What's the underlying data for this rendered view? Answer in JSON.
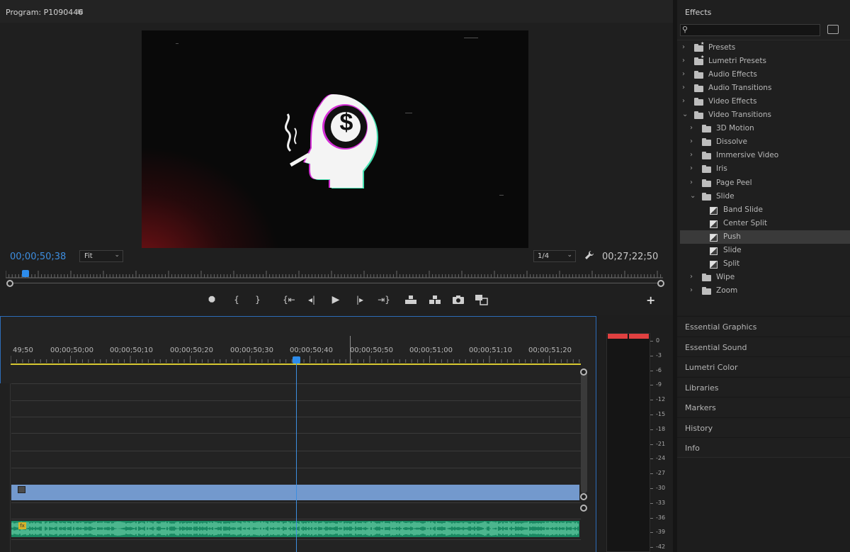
{
  "program": {
    "title": "Program: P1090446",
    "menu_icon": "≡",
    "timecode_current": "00;00;50;38",
    "fit_label": "Fit",
    "resolution_label": "1/4",
    "timecode_duration": "00;27;22;50",
    "add_icon": "+"
  },
  "video": {
    "dollar_symbol": "$"
  },
  "transport": {
    "buttons": [
      {
        "name": "add-marker-button",
        "glyph": "⯃"
      },
      {
        "name": "mark-in-button",
        "glyph": "{"
      },
      {
        "name": "mark-out-button",
        "glyph": "}"
      },
      {
        "name": "go-to-in-button",
        "glyph": "{⇤"
      },
      {
        "name": "step-back-button",
        "glyph": "◂|"
      },
      {
        "name": "play-button",
        "glyph": "▶"
      },
      {
        "name": "step-forward-button",
        "glyph": "|▸"
      },
      {
        "name": "go-to-out-button",
        "glyph": "⇥}"
      }
    ]
  },
  "timeline": {
    "ruler_labels": [
      "49;50",
      "00;00;50;00",
      "00;00;50;10",
      "00;00;50;20",
      "00;00;50;30",
      "00;00;50;40",
      "00;00;50;50",
      "00;00;51;00",
      "00;00;51;10",
      "00;00;51;20"
    ],
    "fx_badge": "fx"
  },
  "meters": {
    "db_labels": [
      "0",
      "-3",
      "-6",
      "-9",
      "-12",
      "-15",
      "-18",
      "-21",
      "-24",
      "-27",
      "-30",
      "-33",
      "-36",
      "-39",
      "-42"
    ]
  },
  "effects": {
    "tab_label": "Effects",
    "tree": [
      {
        "label": "Presets",
        "level": 0,
        "type": "preset-folder",
        "expanded": false
      },
      {
        "label": "Lumetri Presets",
        "level": 0,
        "type": "preset-folder",
        "expanded": false
      },
      {
        "label": "Audio Effects",
        "level": 0,
        "type": "folder",
        "expanded": false
      },
      {
        "label": "Audio Transitions",
        "level": 0,
        "type": "folder",
        "expanded": false
      },
      {
        "label": "Video Effects",
        "level": 0,
        "type": "folder",
        "expanded": false
      },
      {
        "label": "Video Transitions",
        "level": 0,
        "type": "folder",
        "expanded": true
      },
      {
        "label": "3D Motion",
        "level": 1,
        "type": "folder",
        "expanded": false
      },
      {
        "label": "Dissolve",
        "level": 1,
        "type": "folder",
        "expanded": false
      },
      {
        "label": "Immersive Video",
        "level": 1,
        "type": "folder",
        "expanded": false
      },
      {
        "label": "Iris",
        "level": 1,
        "type": "folder",
        "expanded": false
      },
      {
        "label": "Page Peel",
        "level": 1,
        "type": "folder",
        "expanded": false
      },
      {
        "label": "Slide",
        "level": 1,
        "type": "folder",
        "expanded": true
      },
      {
        "label": "Band Slide",
        "level": 2,
        "type": "transition"
      },
      {
        "label": "Center Split",
        "level": 2,
        "type": "transition"
      },
      {
        "label": "Push",
        "level": 2,
        "type": "transition",
        "selected": true
      },
      {
        "label": "Slide",
        "level": 2,
        "type": "transition"
      },
      {
        "label": "Split",
        "level": 2,
        "type": "transition"
      },
      {
        "label": "Wipe",
        "level": 1,
        "type": "folder",
        "expanded": false
      },
      {
        "label": "Zoom",
        "level": 1,
        "type": "folder",
        "expanded": false
      }
    ]
  },
  "panels": [
    "Essential Graphics",
    "Essential Sound",
    "Lumetri Color",
    "Libraries",
    "Markers",
    "History",
    "Info"
  ],
  "colors": {
    "accent_blue": "#3d8ee0",
    "video_clip": "#7399cd",
    "audio_clip": "#1a8a63",
    "in_out_bar": "#d7c830",
    "meter_peak": "#e04040"
  }
}
